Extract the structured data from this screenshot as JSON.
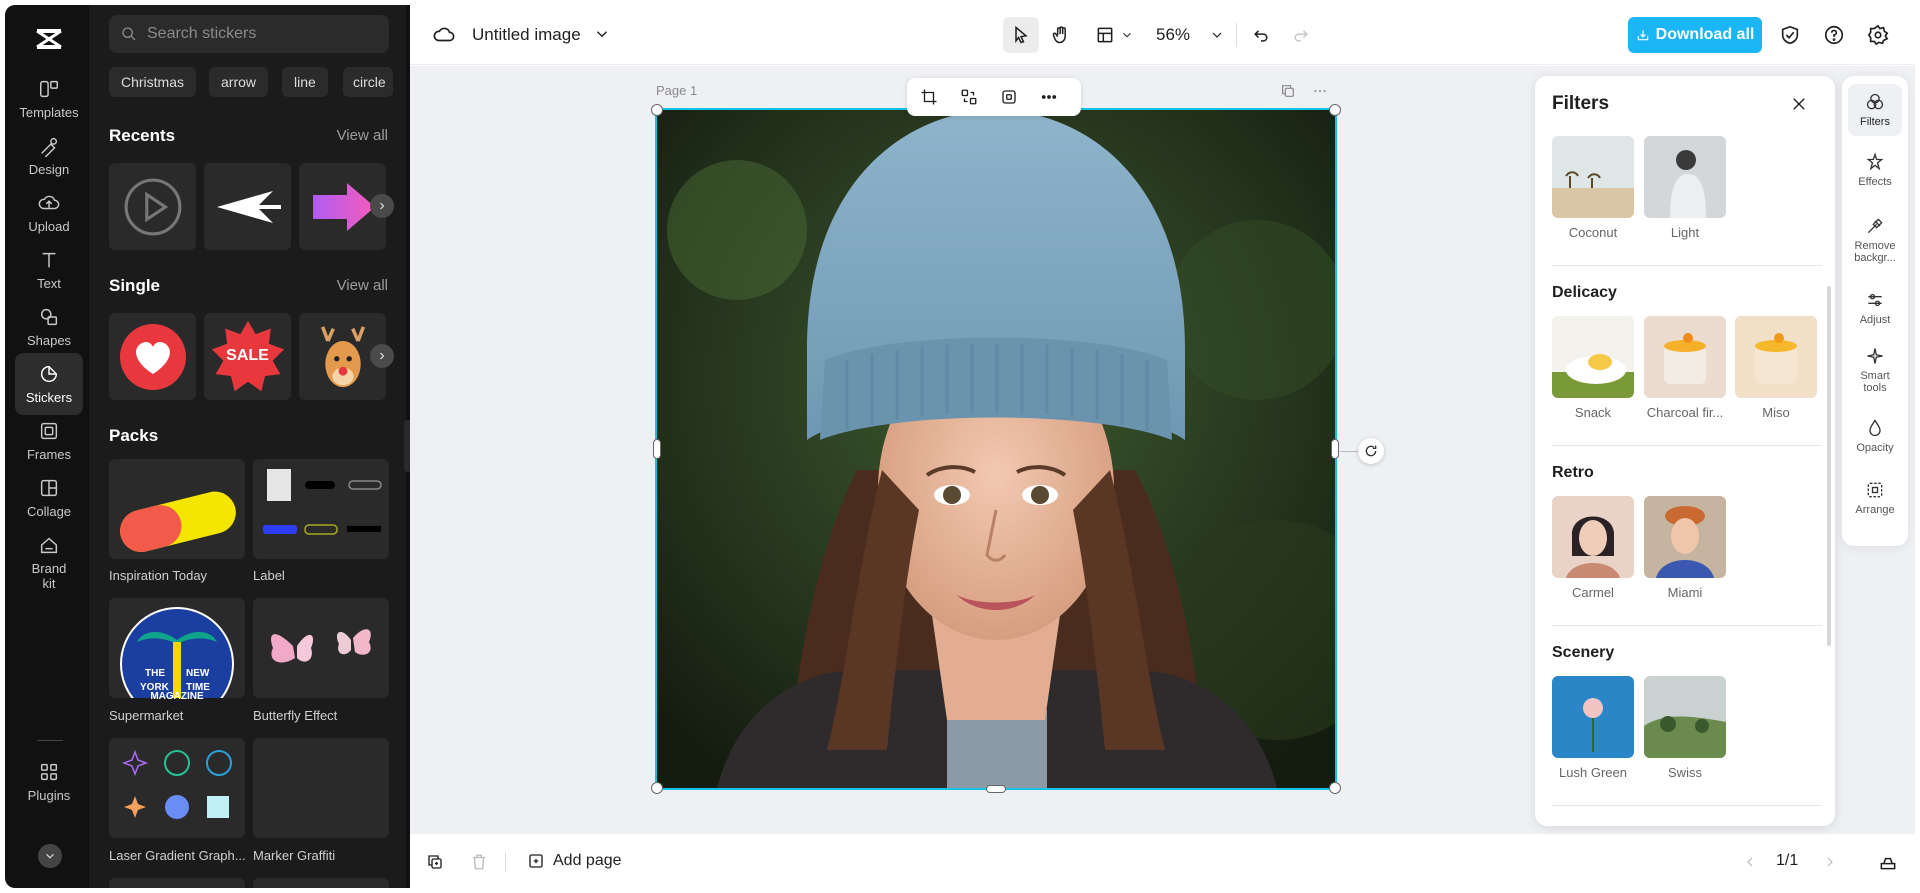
{
  "rail": {
    "items": [
      {
        "label": "Templates",
        "icon": "templates-icon"
      },
      {
        "label": "Design",
        "icon": "design-icon"
      },
      {
        "label": "Upload",
        "icon": "upload-icon"
      },
      {
        "label": "Text",
        "icon": "text-icon"
      },
      {
        "label": "Shapes",
        "icon": "shapes-icon"
      },
      {
        "label": "Stickers",
        "icon": "stickers-icon",
        "active": true
      },
      {
        "label": "Frames",
        "icon": "frames-icon"
      },
      {
        "label": "Collage",
        "icon": "collage-icon"
      },
      {
        "label": "Brand kit",
        "icon": "brand-kit-icon"
      },
      {
        "label": "Plugins",
        "icon": "plugins-icon"
      }
    ]
  },
  "panel": {
    "search_placeholder": "Search stickers",
    "chips": [
      "Christmas",
      "arrow",
      "line",
      "circle"
    ],
    "recents": {
      "title": "Recents",
      "view_all": "View all"
    },
    "single": {
      "title": "Single",
      "view_all": "View all",
      "sale_text": "SALE"
    },
    "packs": {
      "title": "Packs",
      "items": [
        "Inspiration Today",
        "Label",
        "Supermarket",
        "Butterfly Effect",
        "Laser Gradient Graph...",
        "Marker Graffiti"
      ],
      "badge_lines": [
        "THE",
        "NEW",
        "YORK",
        "TIME",
        "MAGAZINE"
      ]
    }
  },
  "topbar": {
    "title": "Untitled image",
    "zoom": "56%",
    "download_label": "Download all"
  },
  "canvas": {
    "page_label": "Page 1"
  },
  "bottombar": {
    "add_page": "Add page",
    "pager": "1/1"
  },
  "filters": {
    "title": "Filters",
    "top_row": [
      "Coconut",
      "Light"
    ],
    "groups": [
      {
        "title": "Delicacy",
        "items": [
          "Snack",
          "Charcoal fir...",
          "Miso"
        ]
      },
      {
        "title": "Retro",
        "items": [
          "Carmel",
          "Miami"
        ]
      },
      {
        "title": "Scenery",
        "items": [
          "Lush Green",
          "Swiss"
        ]
      }
    ]
  },
  "toolrail": {
    "items": [
      {
        "label": "Filters",
        "icon": "filters-icon",
        "active": true
      },
      {
        "label": "Effects",
        "icon": "effects-icon"
      },
      {
        "label": "Remove backgr...",
        "icon": "remove-background-icon"
      },
      {
        "label": "Adjust",
        "icon": "adjust-icon"
      },
      {
        "label": "Smart tools",
        "icon": "smart-tools-icon"
      },
      {
        "label": "Opacity",
        "icon": "opacity-icon"
      },
      {
        "label": "Arrange",
        "icon": "arrange-icon"
      }
    ]
  },
  "colors": {
    "accent": "#1bb6f5",
    "selection": "#13c3e6",
    "rail_bg": "#111111",
    "panel_bg": "#1b1b1b"
  }
}
